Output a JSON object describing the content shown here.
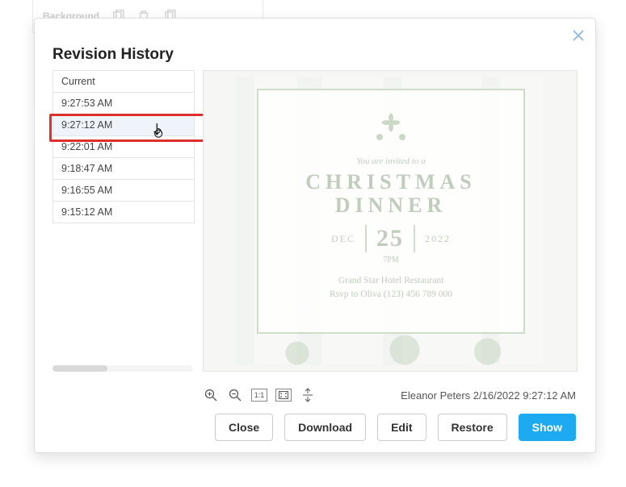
{
  "bg": {
    "label": "Background"
  },
  "modal": {
    "title": "Revision History",
    "revisions": [
      "Current",
      "9:27:53 AM",
      "9:27:12 AM",
      "9:22:01 AM",
      "9:18:47 AM",
      "9:16:55 AM",
      "9:15:12 AM"
    ],
    "selected_index": 2,
    "meta": "Eleanor Peters 2/16/2022 9:27:12 AM",
    "buttons": {
      "close": "Close",
      "download": "Download",
      "edit": "Edit",
      "restore": "Restore",
      "show": "Show"
    }
  },
  "preview": {
    "invite": "You are invited to a",
    "title_line1": "CHRISTMAS",
    "title_line2": "DINNER",
    "month": "DEC",
    "day": "25",
    "year": "2022",
    "time": "7PM",
    "venue": "Grand Star Hotel Restaurant",
    "rsvp": "Rsvp to Oliva (123) 456 789 000"
  },
  "toolbar": {
    "ratio": "1:1"
  }
}
